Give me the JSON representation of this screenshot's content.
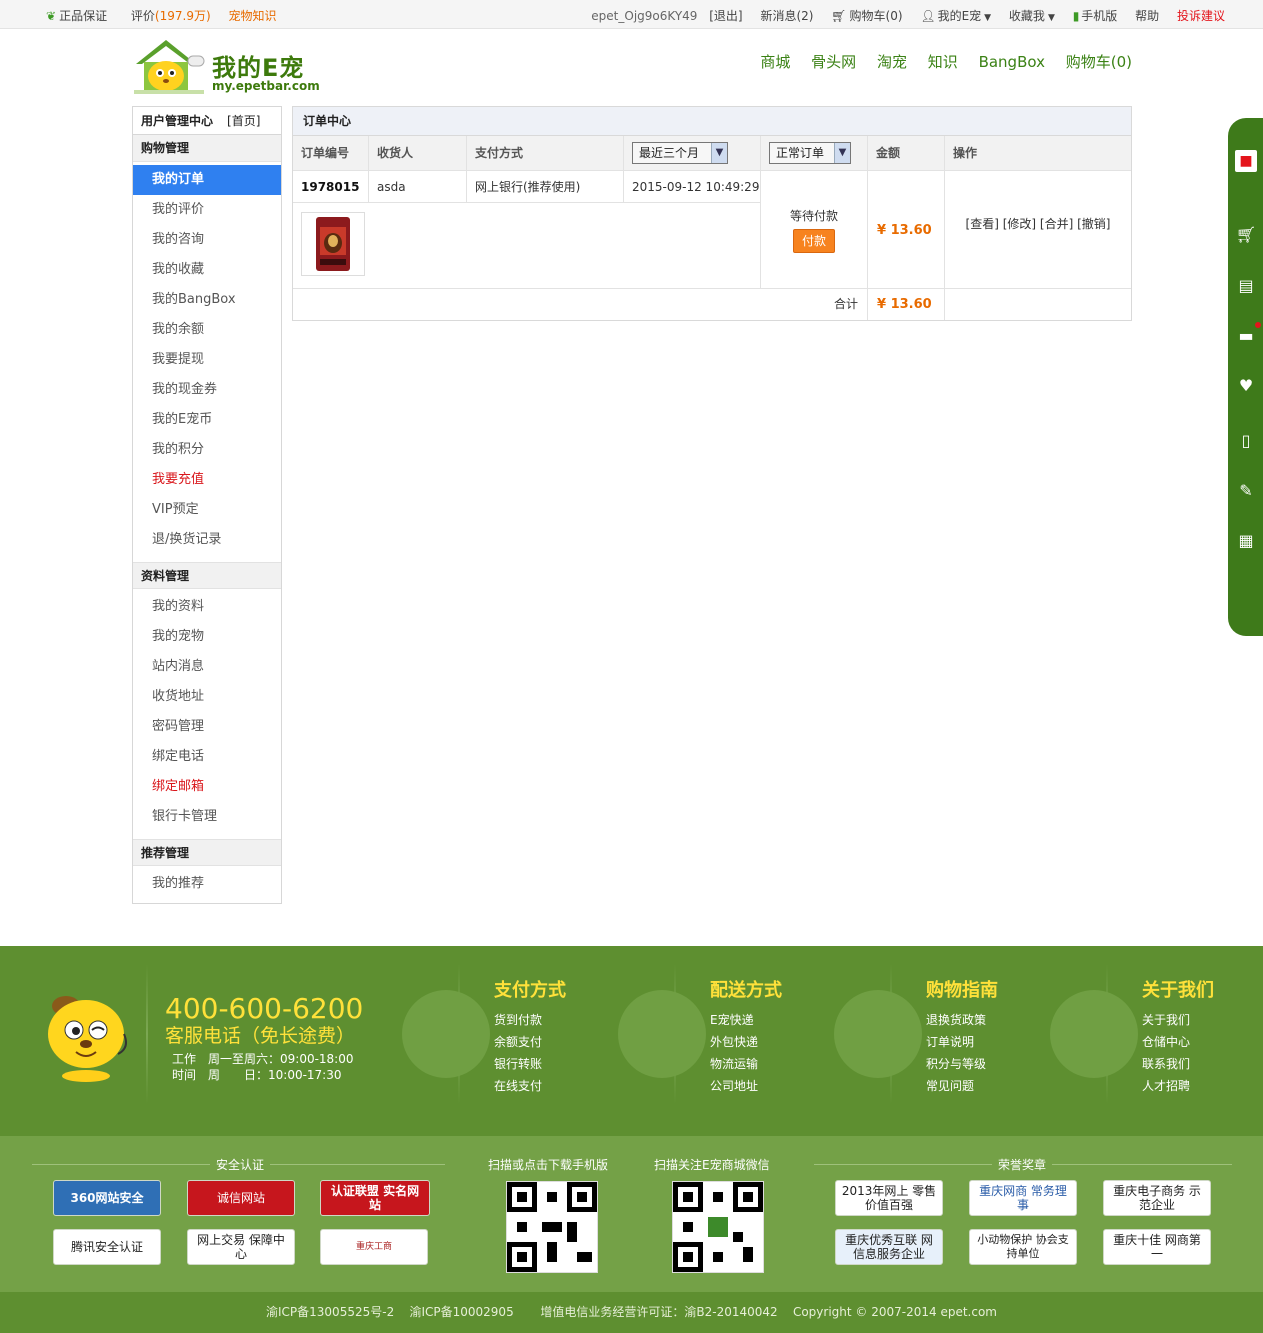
{
  "topbar": {
    "guarantee": "正品保证",
    "review_label": "评价",
    "review_count": "(197.9万)",
    "pet_knowledge": "宠物知识",
    "username": "epet_Ojg9o6KY49",
    "logout": "[退出]",
    "messages": "新消息(2)",
    "cart": "购物车(0)",
    "my_epet": "我的E宠",
    "bookmark": "收藏我",
    "mobile": "手机版",
    "help": "帮助",
    "complaint": "投诉建议"
  },
  "logo": {
    "name": "我的E宠",
    "domain": "my.epetbar.com"
  },
  "main_nav": [
    "商城",
    "骨头网",
    "淘宠",
    "知识",
    "BangBox",
    "购物车(0)"
  ],
  "sidebar": {
    "title": "用户管理中心",
    "home_link": "[首页]",
    "sections": [
      {
        "title": "购物管理",
        "items": [
          "我的订单",
          "我的评价",
          "我的咨询",
          "我的收藏",
          "我的BangBox",
          "我的余额",
          "我要提现",
          "我的现金券",
          "我的E宠币",
          "我的积分",
          "我要充值",
          "VIP预定",
          "退/换货记录"
        ]
      },
      {
        "title": "资料管理",
        "items": [
          "我的资料",
          "我的宠物",
          "站内消息",
          "收货地址",
          "密码管理",
          "绑定电话",
          "绑定邮箱",
          "银行卡管理"
        ]
      },
      {
        "title": "推荐管理",
        "items": [
          "我的推荐"
        ]
      }
    ]
  },
  "order_center": {
    "title": "订单中心",
    "headers": {
      "order_no": "订单编号",
      "receiver": "收货人",
      "payment": "支付方式",
      "amount": "金额",
      "action": "操作"
    },
    "time_filter": "最近三个月",
    "type_filter": "正常订单",
    "order": {
      "order_no": "1978015",
      "receiver": "asda",
      "payment": "网上银行(推荐使用)",
      "time": "2015-09-12 10:49:29",
      "status": "等待付款",
      "pay_button": "付款",
      "amount": "¥ 13.60",
      "actions": "[查看] [修改] [合并] [撤销]"
    },
    "total_label": "合计",
    "total_amount": "¥ 13.60"
  },
  "footer": {
    "phone": "400-600-6200",
    "phone_desc": "客服电话（免长途费）",
    "hours_label_1": "工作",
    "hours_label_2": "时间",
    "hours_1": "周一至周六：09:00-18:00",
    "hours_2": "周　　日：10:00-17:30",
    "columns": [
      {
        "title": "支付方式",
        "links": [
          "货到付款",
          "余额支付",
          "银行转账",
          "在线支付"
        ]
      },
      {
        "title": "配送方式",
        "links": [
          "E宠快递",
          "外包快递",
          "物流运输",
          "公司地址"
        ]
      },
      {
        "title": "购物指南",
        "links": [
          "退换货政策",
          "订单说明",
          "积分与等级",
          "常见问题"
        ]
      },
      {
        "title": "关于我们",
        "links": [
          "关于我们",
          "仓储中心",
          "联系我们",
          "人才招聘"
        ]
      }
    ]
  },
  "certs": {
    "security_title": "安全认证",
    "qr1_title": "扫描或点击下载手机版",
    "qr2_title": "扫描关注E宠商城微信",
    "honor_title": "荣誉奖章",
    "security_badges": [
      "360网站安全",
      "诚信网站",
      "认证联盟 实名网站",
      "腾讯安全认证",
      "网上交易 保障中心",
      "重庆工商"
    ],
    "honor_badges": [
      "2013年网上 零售价值百强",
      "重庆网商 常务理事",
      "重庆电子商务 示范企业",
      "重庆优秀互联 网信息服务企业",
      "小动物保护 协会支持单位",
      "重庆十佳 网商第一"
    ]
  },
  "bottom": {
    "icp1": "渝ICP备13005525号-2",
    "icp2": "渝ICP备10002905",
    "license": "增值电信业务经营许可证：渝B2-20140042",
    "copyright": "Copyright © 2007-2014 epet.com"
  },
  "colors": {
    "brand_green": "#5e8f30",
    "accent_orange": "#e86b00",
    "active_blue": "#2f80f0",
    "alert_red": "#e4141b"
  }
}
